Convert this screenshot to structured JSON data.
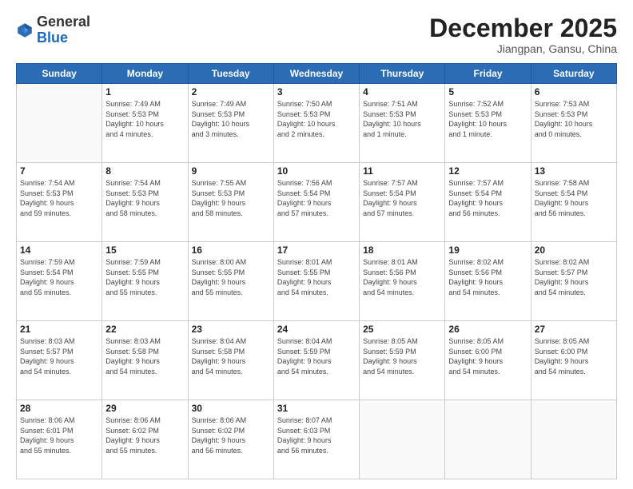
{
  "header": {
    "logo_general": "General",
    "logo_blue": "Blue",
    "month_title": "December 2025",
    "location": "Jiangpan, Gansu, China"
  },
  "weekdays": [
    "Sunday",
    "Monday",
    "Tuesday",
    "Wednesday",
    "Thursday",
    "Friday",
    "Saturday"
  ],
  "weeks": [
    [
      {
        "day": "",
        "info": ""
      },
      {
        "day": "1",
        "info": "Sunrise: 7:49 AM\nSunset: 5:53 PM\nDaylight: 10 hours\nand 4 minutes."
      },
      {
        "day": "2",
        "info": "Sunrise: 7:49 AM\nSunset: 5:53 PM\nDaylight: 10 hours\nand 3 minutes."
      },
      {
        "day": "3",
        "info": "Sunrise: 7:50 AM\nSunset: 5:53 PM\nDaylight: 10 hours\nand 2 minutes."
      },
      {
        "day": "4",
        "info": "Sunrise: 7:51 AM\nSunset: 5:53 PM\nDaylight: 10 hours\nand 1 minute."
      },
      {
        "day": "5",
        "info": "Sunrise: 7:52 AM\nSunset: 5:53 PM\nDaylight: 10 hours\nand 1 minute."
      },
      {
        "day": "6",
        "info": "Sunrise: 7:53 AM\nSunset: 5:53 PM\nDaylight: 10 hours\nand 0 minutes."
      }
    ],
    [
      {
        "day": "7",
        "info": "Sunrise: 7:54 AM\nSunset: 5:53 PM\nDaylight: 9 hours\nand 59 minutes."
      },
      {
        "day": "8",
        "info": "Sunrise: 7:54 AM\nSunset: 5:53 PM\nDaylight: 9 hours\nand 58 minutes."
      },
      {
        "day": "9",
        "info": "Sunrise: 7:55 AM\nSunset: 5:53 PM\nDaylight: 9 hours\nand 58 minutes."
      },
      {
        "day": "10",
        "info": "Sunrise: 7:56 AM\nSunset: 5:54 PM\nDaylight: 9 hours\nand 57 minutes."
      },
      {
        "day": "11",
        "info": "Sunrise: 7:57 AM\nSunset: 5:54 PM\nDaylight: 9 hours\nand 57 minutes."
      },
      {
        "day": "12",
        "info": "Sunrise: 7:57 AM\nSunset: 5:54 PM\nDaylight: 9 hours\nand 56 minutes."
      },
      {
        "day": "13",
        "info": "Sunrise: 7:58 AM\nSunset: 5:54 PM\nDaylight: 9 hours\nand 56 minutes."
      }
    ],
    [
      {
        "day": "14",
        "info": "Sunrise: 7:59 AM\nSunset: 5:54 PM\nDaylight: 9 hours\nand 55 minutes."
      },
      {
        "day": "15",
        "info": "Sunrise: 7:59 AM\nSunset: 5:55 PM\nDaylight: 9 hours\nand 55 minutes."
      },
      {
        "day": "16",
        "info": "Sunrise: 8:00 AM\nSunset: 5:55 PM\nDaylight: 9 hours\nand 55 minutes."
      },
      {
        "day": "17",
        "info": "Sunrise: 8:01 AM\nSunset: 5:55 PM\nDaylight: 9 hours\nand 54 minutes."
      },
      {
        "day": "18",
        "info": "Sunrise: 8:01 AM\nSunset: 5:56 PM\nDaylight: 9 hours\nand 54 minutes."
      },
      {
        "day": "19",
        "info": "Sunrise: 8:02 AM\nSunset: 5:56 PM\nDaylight: 9 hours\nand 54 minutes."
      },
      {
        "day": "20",
        "info": "Sunrise: 8:02 AM\nSunset: 5:57 PM\nDaylight: 9 hours\nand 54 minutes."
      }
    ],
    [
      {
        "day": "21",
        "info": "Sunrise: 8:03 AM\nSunset: 5:57 PM\nDaylight: 9 hours\nand 54 minutes."
      },
      {
        "day": "22",
        "info": "Sunrise: 8:03 AM\nSunset: 5:58 PM\nDaylight: 9 hours\nand 54 minutes."
      },
      {
        "day": "23",
        "info": "Sunrise: 8:04 AM\nSunset: 5:58 PM\nDaylight: 9 hours\nand 54 minutes."
      },
      {
        "day": "24",
        "info": "Sunrise: 8:04 AM\nSunset: 5:59 PM\nDaylight: 9 hours\nand 54 minutes."
      },
      {
        "day": "25",
        "info": "Sunrise: 8:05 AM\nSunset: 5:59 PM\nDaylight: 9 hours\nand 54 minutes."
      },
      {
        "day": "26",
        "info": "Sunrise: 8:05 AM\nSunset: 6:00 PM\nDaylight: 9 hours\nand 54 minutes."
      },
      {
        "day": "27",
        "info": "Sunrise: 8:05 AM\nSunset: 6:00 PM\nDaylight: 9 hours\nand 54 minutes."
      }
    ],
    [
      {
        "day": "28",
        "info": "Sunrise: 8:06 AM\nSunset: 6:01 PM\nDaylight: 9 hours\nand 55 minutes."
      },
      {
        "day": "29",
        "info": "Sunrise: 8:06 AM\nSunset: 6:02 PM\nDaylight: 9 hours\nand 55 minutes."
      },
      {
        "day": "30",
        "info": "Sunrise: 8:06 AM\nSunset: 6:02 PM\nDaylight: 9 hours\nand 56 minutes."
      },
      {
        "day": "31",
        "info": "Sunrise: 8:07 AM\nSunset: 6:03 PM\nDaylight: 9 hours\nand 56 minutes."
      },
      {
        "day": "",
        "info": ""
      },
      {
        "day": "",
        "info": ""
      },
      {
        "day": "",
        "info": ""
      }
    ]
  ]
}
